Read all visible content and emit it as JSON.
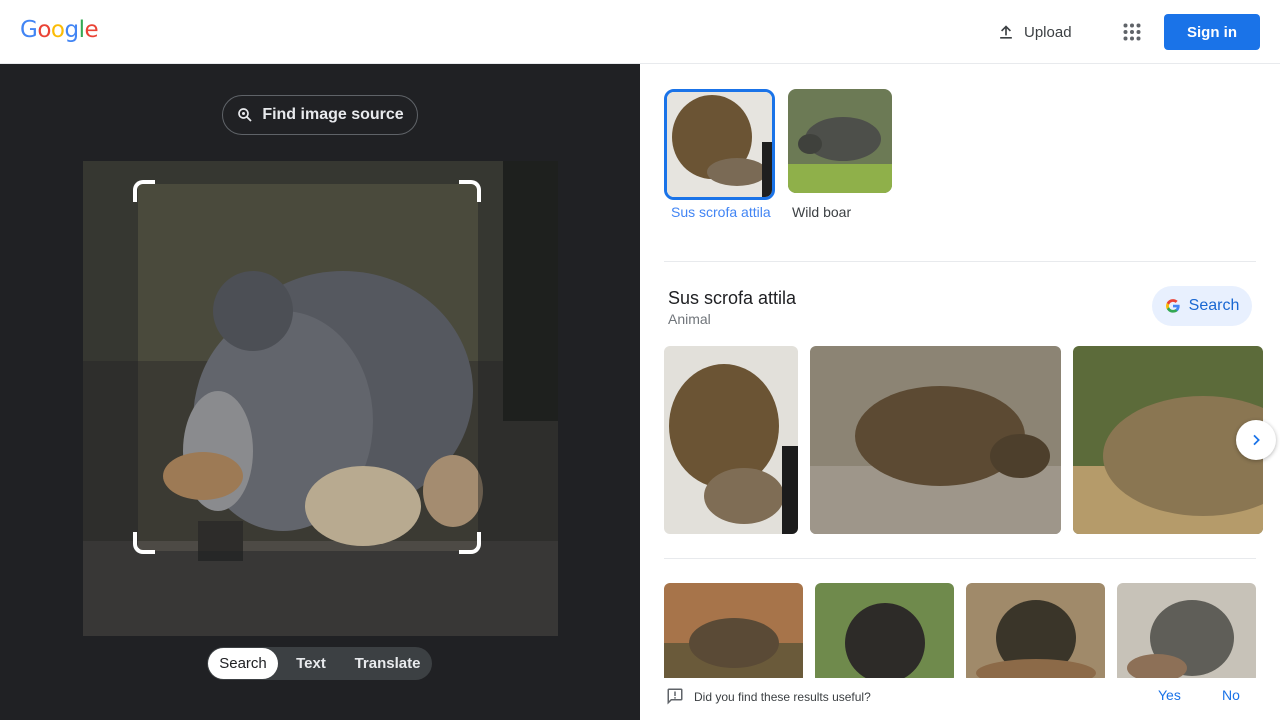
{
  "header": {
    "logo_letters": [
      {
        "ch": "G",
        "color": "#4285f4"
      },
      {
        "ch": "o",
        "color": "#ea4335"
      },
      {
        "ch": "o",
        "color": "#fbbc05"
      },
      {
        "ch": "g",
        "color": "#4285f4"
      },
      {
        "ch": "l",
        "color": "#34a853"
      },
      {
        "ch": "e",
        "color": "#ea4335"
      }
    ],
    "upload_label": "Upload",
    "apps_icon": "apps-grid-icon",
    "signin_label": "Sign in"
  },
  "left": {
    "find_source_label": "Find image source",
    "modes": [
      {
        "label": "Search",
        "active": true
      },
      {
        "label": "Text",
        "active": false
      },
      {
        "label": "Translate",
        "active": false
      }
    ]
  },
  "right": {
    "chips": [
      {
        "label": "Sus scrofa attila",
        "selected": true
      },
      {
        "label": "Wild boar",
        "selected": false
      }
    ],
    "entity": {
      "title": "Sus scrofa attila",
      "subtitle": "Animal",
      "search_label": "Search"
    },
    "feedback": {
      "question": "Did you find these results useful?",
      "yes": "Yes",
      "no": "No"
    }
  },
  "colors": {
    "accent": "#1a73e8",
    "dark_panel": "#202124"
  }
}
